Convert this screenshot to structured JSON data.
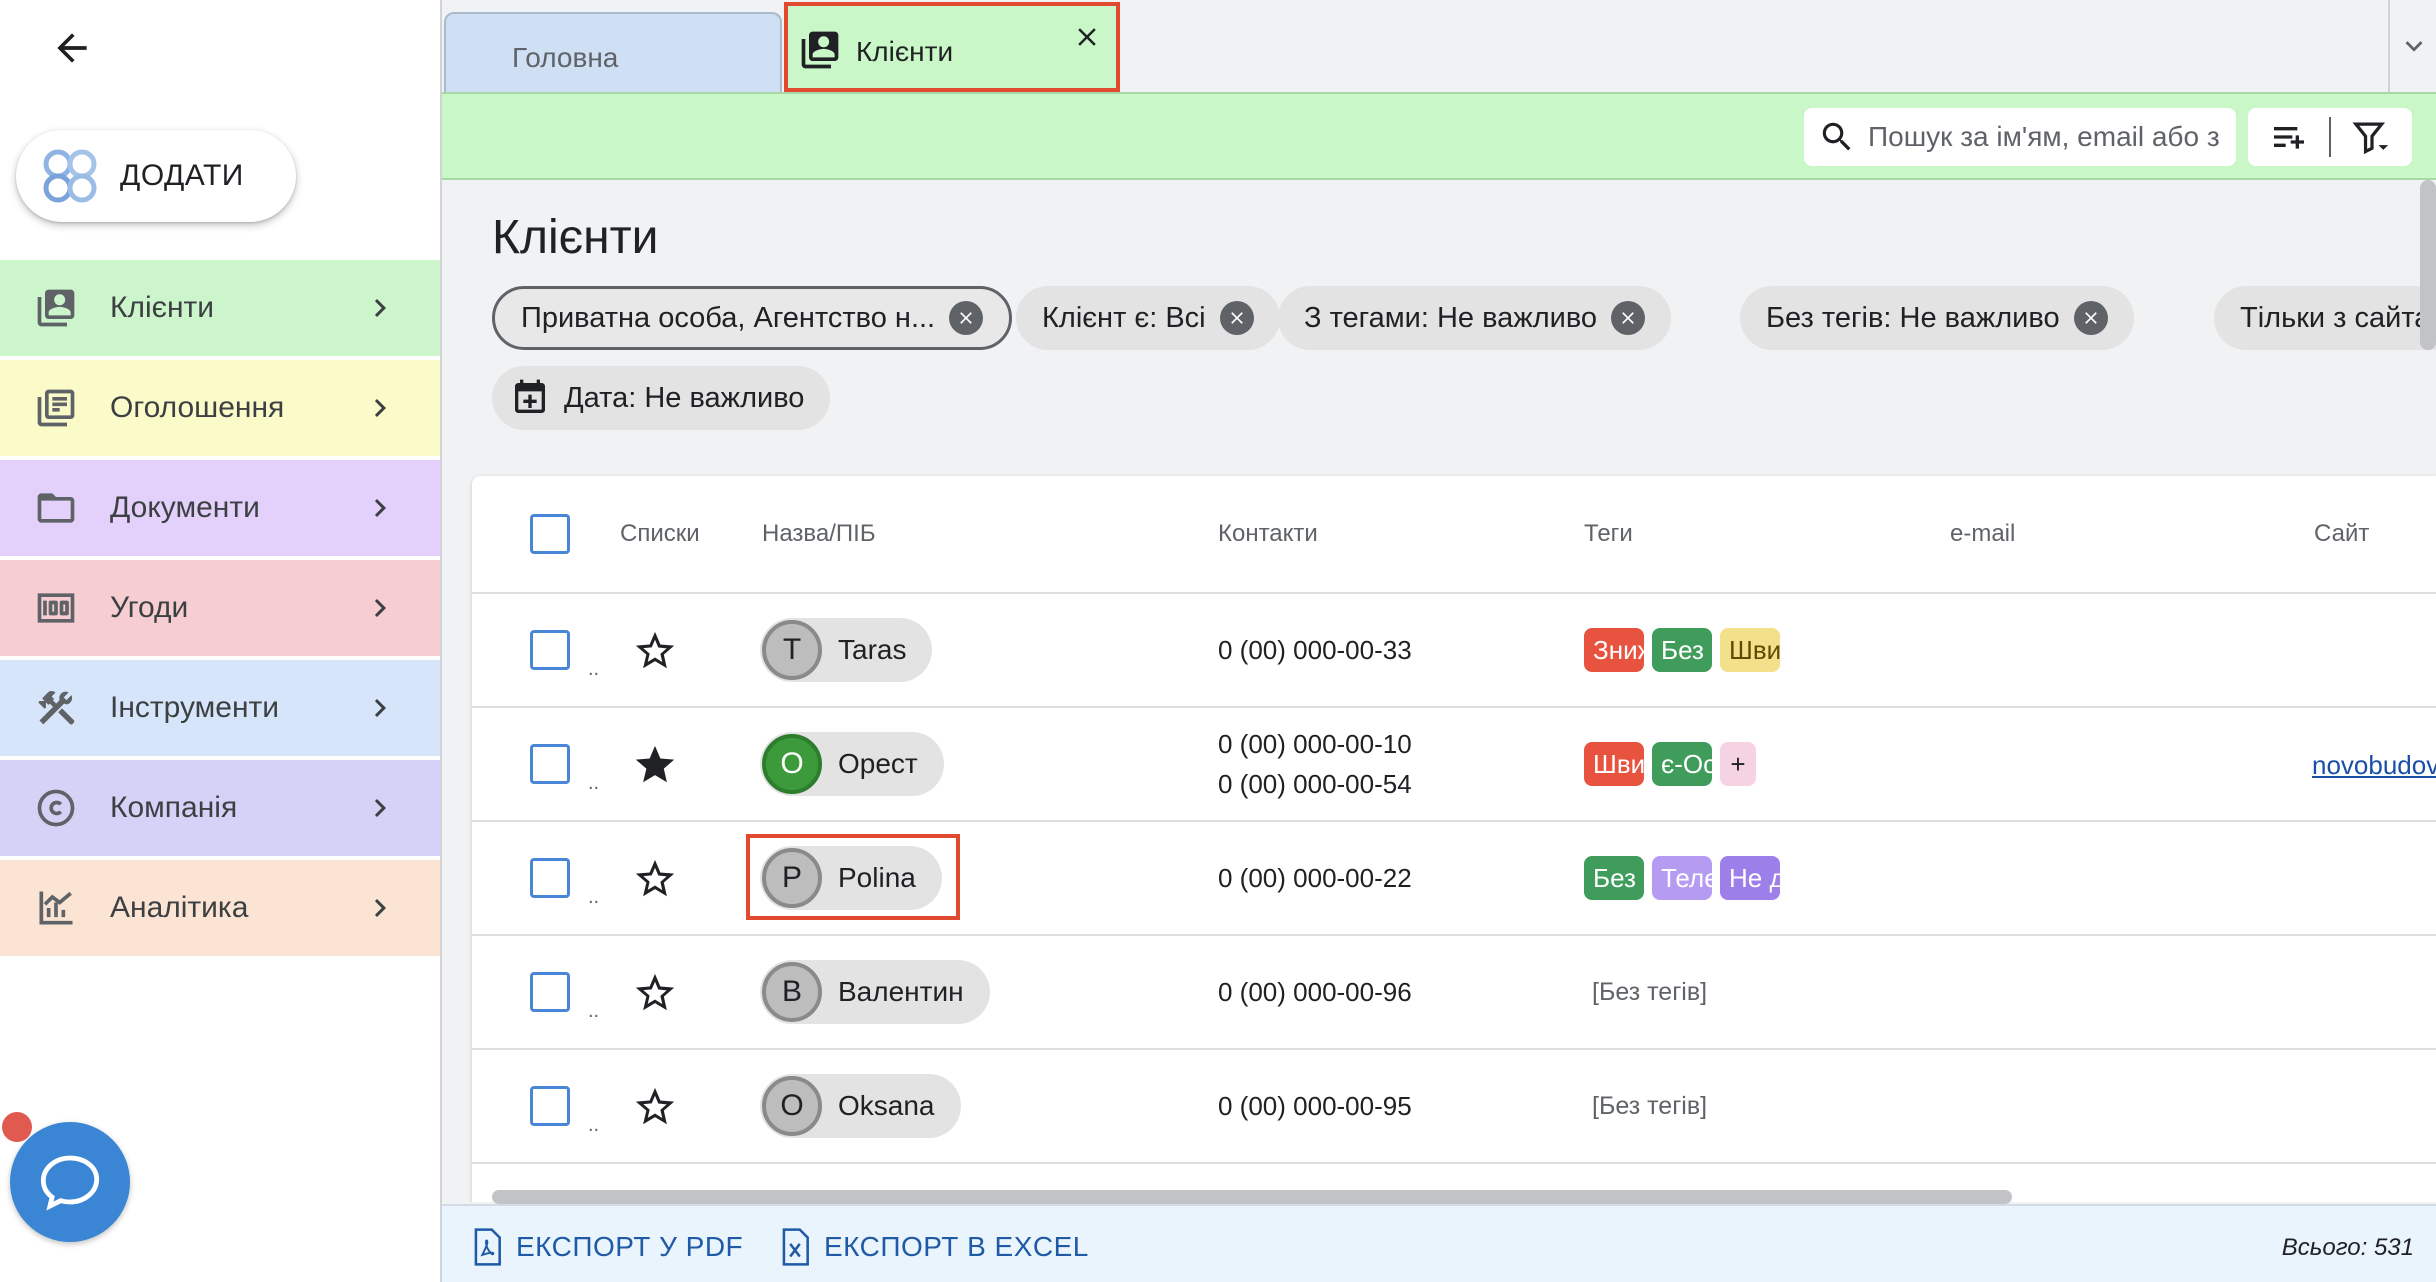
{
  "sidebar": {
    "add_label": "ДОДАТИ",
    "items": [
      {
        "label": "Клієнти",
        "icon": "contacts-icon",
        "color": "#ccf5cc"
      },
      {
        "label": "Оголошення",
        "icon": "listings-icon",
        "color": "#fbfbca"
      },
      {
        "label": "Документи",
        "icon": "folder-icon",
        "color": "#e3d1fb"
      },
      {
        "label": "Угоди",
        "icon": "money-icon",
        "color": "#f6cdd0"
      },
      {
        "label": "Інструменти",
        "icon": "tools-icon",
        "color": "#d6e5fa"
      },
      {
        "label": "Компанія",
        "icon": "copyright-icon",
        "color": "#d5d2f8"
      },
      {
        "label": "Аналітика",
        "icon": "analytics-icon",
        "color": "#fbe4d3"
      }
    ]
  },
  "tabs": {
    "home": "Головна",
    "clients": "Клієнти"
  },
  "search": {
    "placeholder": "Пошук за ім'ям, email або з"
  },
  "page": {
    "title": "Клієнти"
  },
  "filters": [
    {
      "label": "Приватна особа, Агентство н...",
      "removable": true,
      "outlined": true
    },
    {
      "label": "Клієнт є: Всі",
      "removable": true
    },
    {
      "label": "З тегами: Не важливо",
      "removable": true
    },
    {
      "label": "Без тегів: Не важливо",
      "removable": true
    },
    {
      "label": "Тільки з сайтами",
      "removable": false
    },
    {
      "label": "Дата: Не важливо",
      "removable": false,
      "icon": "calendar-plus-icon"
    }
  ],
  "table": {
    "headers": {
      "lists": "Списки",
      "name": "Назва/ПІБ",
      "contacts": "Контакти",
      "tags": "Теги",
      "email": "e-mail",
      "site": "Сайт"
    },
    "rows": [
      {
        "initial": "T",
        "name": "Taras",
        "starred": false,
        "contacts": [
          "0 (00) 000-00-33"
        ],
        "tags": [
          {
            "text": "Зниж",
            "color": "#e8533f"
          },
          {
            "text": "Без",
            "color": "#3f9c5a"
          },
          {
            "text": "Шви",
            "color": "#f3e08a"
          }
        ]
      },
      {
        "initial": "О",
        "name": "Орест",
        "starred": true,
        "contacts": [
          "0 (00) 000-00-10",
          "0 (00) 000-00-54"
        ],
        "tags": [
          {
            "text": "Шви",
            "color": "#e8533f"
          },
          {
            "text": "є-Ос",
            "color": "#3f9c5a"
          },
          {
            "text": "+",
            "color": "#f6d3e3"
          }
        ],
        "site": "novobudova"
      },
      {
        "initial": "P",
        "name": "Polina",
        "starred": false,
        "contacts": [
          "0 (00) 000-00-22"
        ],
        "tags": [
          {
            "text": "Без",
            "color": "#3f9c5a"
          },
          {
            "text": "Теле",
            "color": "#b59cf2"
          },
          {
            "text": "Не д",
            "color": "#9c7fe8"
          }
        ]
      },
      {
        "initial": "В",
        "name": "Валентин",
        "starred": false,
        "contacts": [
          "0 (00) 000-00-96"
        ],
        "no_tags": "[Без тегів]"
      },
      {
        "initial": "O",
        "name": "Oksana",
        "starred": false,
        "contacts": [
          "0 (00) 000-00-95"
        ],
        "no_tags": "[Без тегів]"
      }
    ]
  },
  "footer": {
    "export_pdf": "ЕКСПОРТ У PDF",
    "export_excel": "ЕКСПОРТ В EXCEL",
    "total": "Всього: 531"
  },
  "colors": {
    "accent_green": "#c9f7c7",
    "highlight_red": "#e24a30",
    "link_blue": "#1f5aa6",
    "chat_blue": "#3b86d4"
  }
}
